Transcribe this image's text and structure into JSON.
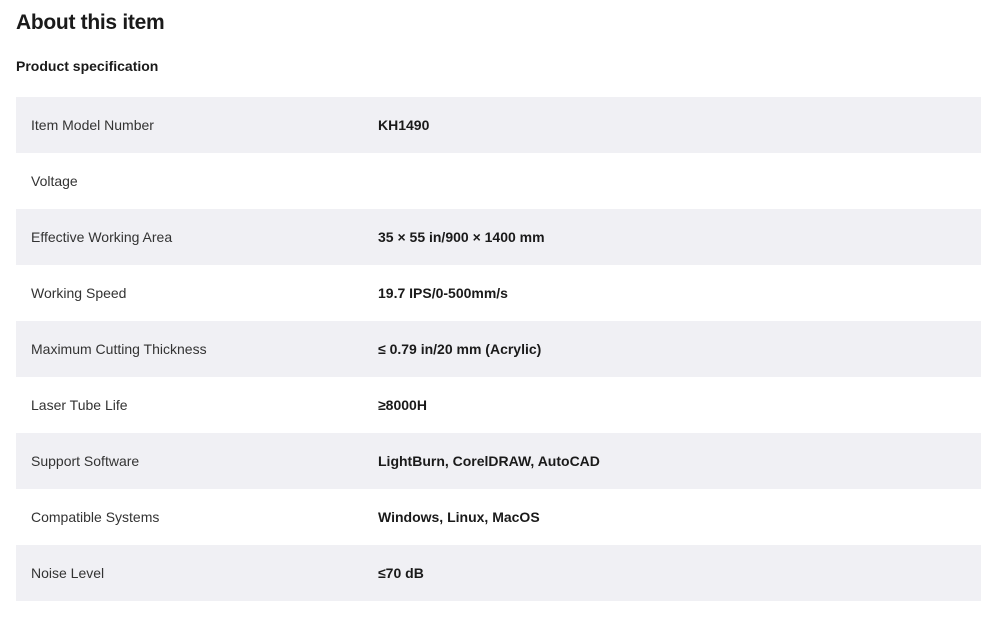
{
  "header": {
    "title": "About this item",
    "section_title": "Product specification"
  },
  "specifications": [
    {
      "label": "Item Model Number",
      "value": "KH1490"
    },
    {
      "label": "Voltage",
      "value": ""
    },
    {
      "label": "Effective Working Area",
      "value": "35 × 55 in/900 × 1400 mm"
    },
    {
      "label": "Working Speed",
      "value": "19.7 IPS/0-500mm/s"
    },
    {
      "label": "Maximum Cutting Thickness",
      "value": "≤ 0.79 in/20 mm (Acrylic)"
    },
    {
      "label": "Laser Tube Life",
      "value": "≥8000H"
    },
    {
      "label": "Support Software",
      "value": "LightBurn, CorelDRAW, AutoCAD"
    },
    {
      "label": "Compatible Systems",
      "value": "Windows, Linux, MacOS"
    },
    {
      "label": "Noise Level",
      "value": "≤70 dB"
    }
  ],
  "colors": {
    "row_alt": "#f0f0f4",
    "text": "#1a1a1a"
  }
}
